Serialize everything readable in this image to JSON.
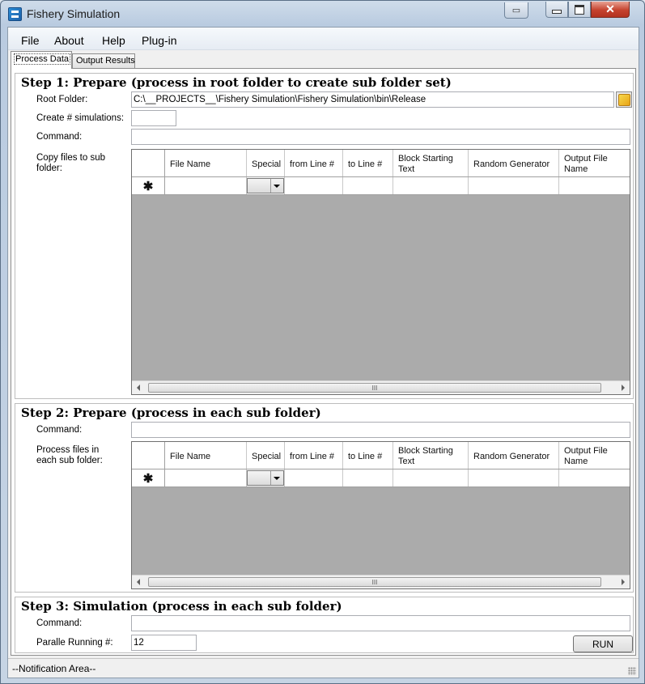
{
  "window": {
    "title": "Fishery Simulation",
    "icon": "app-icon"
  },
  "menu": {
    "items": [
      "File",
      "About",
      "Help",
      "Plug-in"
    ]
  },
  "tabs": {
    "items": [
      "Process Data",
      "Output Results"
    ],
    "active": "Process Data"
  },
  "step1": {
    "title": "Step 1: Prepare (process in root folder to create sub folder set)",
    "root_folder_label": "Root Folder:",
    "root_folder_value": "C:\\__PROJECTS__\\Fishery Simulation\\Fishery Simulation\\bin\\Release",
    "create_sims_label": "Create # simulations:",
    "create_sims_value": "",
    "command_label": "Command:",
    "command_value": "",
    "copy_files_label": "Copy files to sub folder:"
  },
  "step2": {
    "title": "Step 2: Prepare (process in each sub folder)",
    "command_label": "Command:",
    "command_value": "",
    "process_files_label": "Process files in each sub folder:"
  },
  "step3": {
    "title": "Step 3: Simulation (process in each sub folder)",
    "command_label": "Command:",
    "command_value": "",
    "parallel_label": "Paralle Running #:",
    "parallel_value": "12",
    "run_label": "RUN"
  },
  "grid": {
    "columns": [
      "File Name",
      "Special",
      "from Line #",
      "to Line #",
      "Block Starting Text",
      "Random Generator",
      "Output File Name"
    ],
    "new_row_marker": "✱",
    "scroll_thumb_marker": "III"
  },
  "status": {
    "text": "--Notification Area--"
  }
}
